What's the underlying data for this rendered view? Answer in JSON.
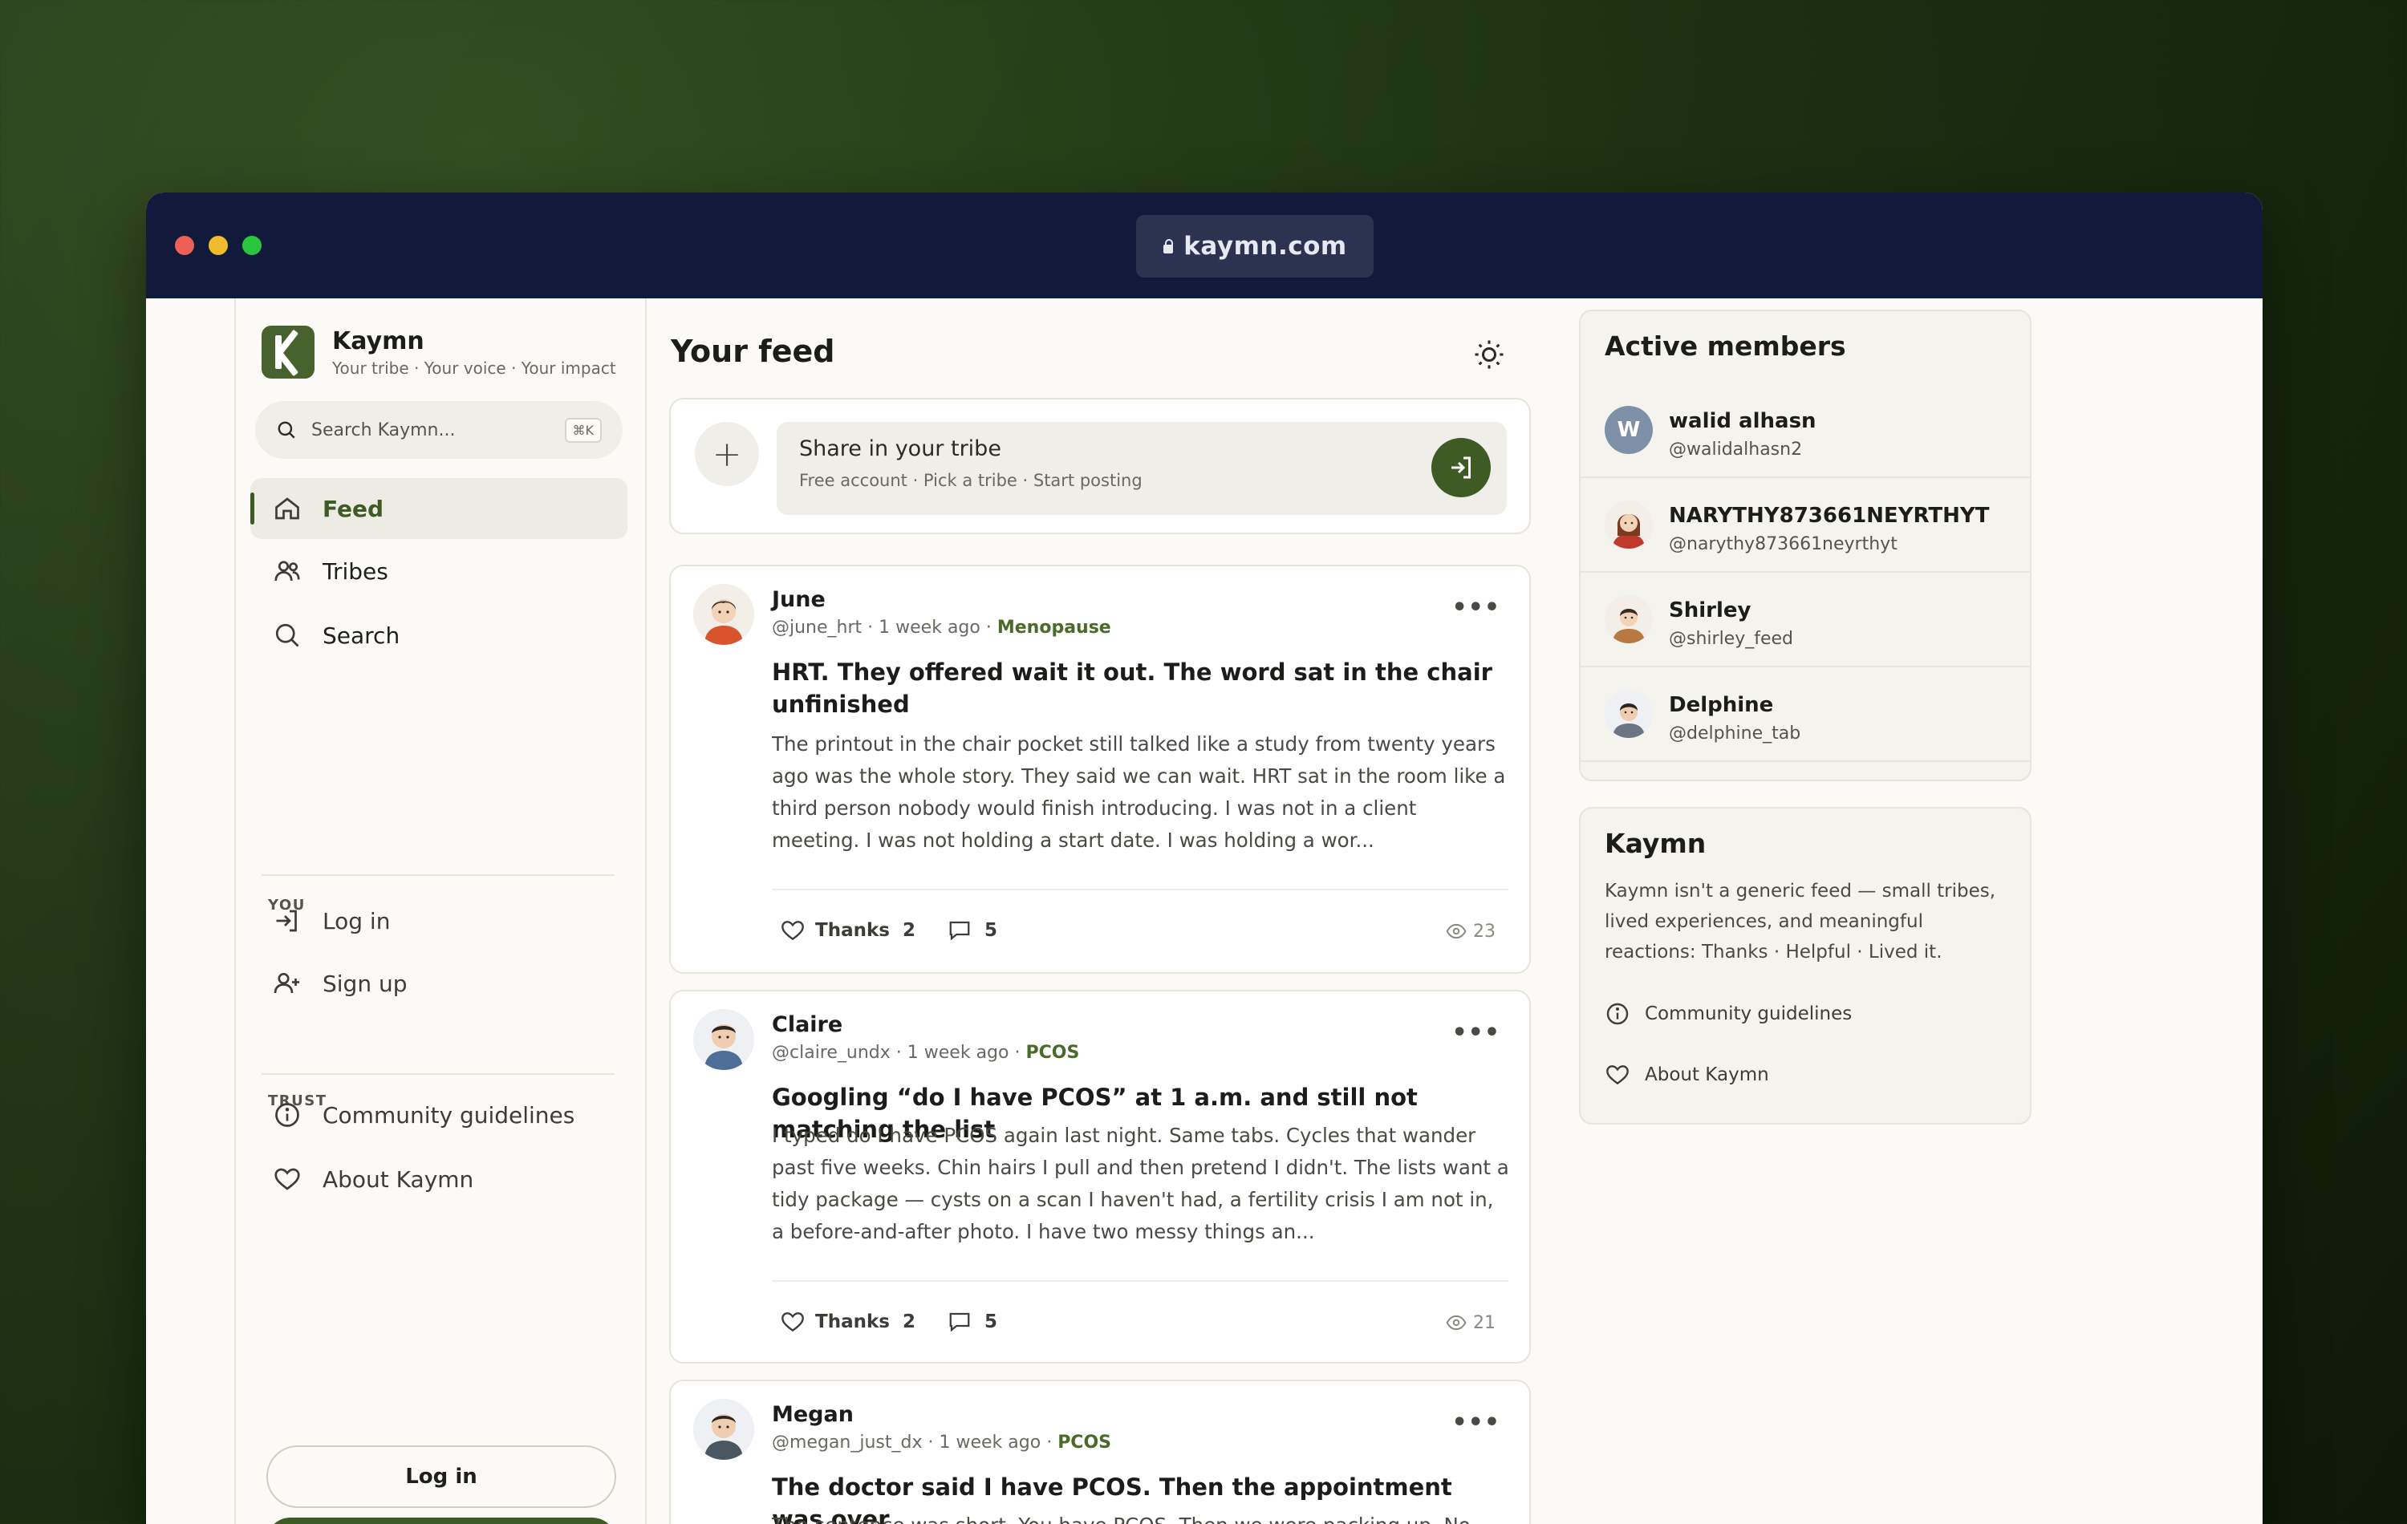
{
  "browser": {
    "url": "kaymn.com"
  },
  "sidebar": {
    "brand_name": "Kaymn",
    "brand_tagline": "Your tribe · Your voice · Your impact",
    "search_placeholder": "Search Kaymn...",
    "search_shortcut": "⌘K",
    "nav": [
      {
        "label": "Feed",
        "icon": "home-icon",
        "active": true
      },
      {
        "label": "Tribes",
        "icon": "users-icon"
      },
      {
        "label": "Search",
        "icon": "search-icon"
      }
    ],
    "you_label": "YOU",
    "you_items": [
      {
        "label": "Log in",
        "icon": "login-icon"
      },
      {
        "label": "Sign up",
        "icon": "user-plus-icon"
      }
    ],
    "trust_label": "TRUST",
    "trust_items": [
      {
        "label": "Community guidelines",
        "icon": "info-icon"
      },
      {
        "label": "About Kaymn",
        "icon": "heart-icon"
      }
    ],
    "login_button": "Log in"
  },
  "feed": {
    "title": "Your feed",
    "composer": {
      "title": "Share in your tribe",
      "subtitle": "Free account · Pick a tribe · Start posting"
    },
    "posts": [
      {
        "author": "June",
        "handle": "@june_hrt",
        "time": "1 week ago",
        "tribe": "Menopause",
        "title": "HRT. They offered wait it out. The word sat in the chair unfinished",
        "body": "The printout in the chair pocket still talked like a study from twenty years ago was the whole story. They said we can wait. HRT sat in the room like a third person nobody would finish introducing. I was not in a client meeting. I was not holding a start date. I was holding a wor...",
        "thanks_label": "Thanks",
        "thanks_count": "2",
        "comments": "5",
        "views": "23"
      },
      {
        "author": "Claire",
        "handle": "@claire_undx",
        "time": "1 week ago",
        "tribe": "PCOS",
        "title": "Googling “do I have PCOS” at 1 a.m. and still not matching the list",
        "body": "I typed do I have PCOS again last night. Same tabs. Cycles that wander past five weeks. Chin hairs I pull and then pretend I didn't. The lists want a tidy package — cysts on a scan I haven't had, a fertility crisis I am not in, a before-and-after photo. I have two messy things an...",
        "thanks_label": "Thanks",
        "thanks_count": "2",
        "comments": "5",
        "views": "21"
      },
      {
        "author": "Megan",
        "handle": "@megan_just_dx",
        "time": "1 week ago",
        "tribe": "PCOS",
        "title": "The doctor said I have PCOS. Then the appointment was over",
        "body": "The sentence was short. You have PCOS. Then we were packing up. No"
      }
    ]
  },
  "rail": {
    "members_title": "Active members",
    "members": [
      {
        "name": "walid alhasn",
        "handle": "@walidalhasn2",
        "initial": "W"
      },
      {
        "name": "NARYTHY873661NEYRTHYT",
        "handle": "@narythy873661neyrthyt"
      },
      {
        "name": "Shirley",
        "handle": "@shirley_feed"
      },
      {
        "name": "Delphine",
        "handle": "@delphine_tab"
      }
    ],
    "about_title": "Kaymn",
    "about_text": "Kaymn isn't a generic feed — small tribes, lived experiences, and meaningful reactions: Thanks · Helpful · Lived it.",
    "links": [
      {
        "label": "Community guidelines",
        "icon": "info-icon"
      },
      {
        "label": "About Kaymn",
        "icon": "heart-icon"
      }
    ]
  },
  "colors": {
    "accent": "#3e5a25",
    "titlebar": "#111a3a",
    "background": "#1f3513"
  }
}
